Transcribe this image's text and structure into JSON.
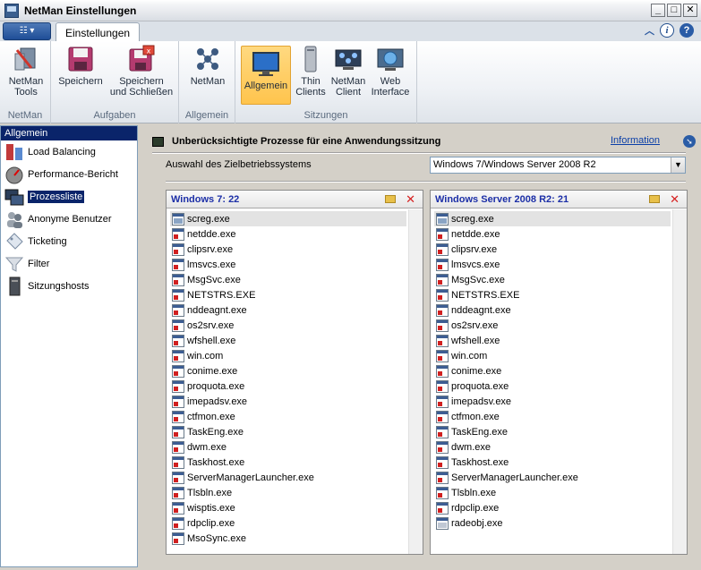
{
  "window": {
    "title": "NetMan Einstellungen",
    "controls": {
      "minimize": "_",
      "maximize": "□",
      "close": "✕"
    }
  },
  "tabs": {
    "app_menu": "☷ ▾",
    "active_tab": "Einstellungen"
  },
  "ribbon": {
    "groups": [
      {
        "label": "NetMan",
        "buttons": [
          {
            "label1": "NetMan",
            "label2": "Tools",
            "icon": "tools-icon"
          }
        ]
      },
      {
        "label": "Aufgaben",
        "buttons": [
          {
            "label1": "Speichern",
            "label2": "",
            "icon": "save-icon"
          },
          {
            "label1": "Speichern",
            "label2": "und Schließen",
            "icon": "save-close-icon"
          }
        ]
      },
      {
        "label": "Allgemein",
        "buttons": [
          {
            "label1": "NetMan",
            "label2": "",
            "icon": "network-icon"
          }
        ]
      },
      {
        "label": "Sitzungen",
        "buttons": [
          {
            "label1": "Allgemein",
            "label2": "",
            "icon": "monitor-icon",
            "active": true
          },
          {
            "label1": "Thin",
            "label2": "Clients",
            "icon": "thin-client-icon"
          },
          {
            "label1": "NetMan",
            "label2": "Client",
            "icon": "netman-client-icon"
          },
          {
            "label1": "Web",
            "label2": "Interface",
            "icon": "web-interface-icon"
          }
        ]
      }
    ]
  },
  "sidebar": {
    "header": "Allgemein",
    "items": [
      {
        "label": "Load Balancing",
        "icon": "load-balancing-icon"
      },
      {
        "label": "Performance-Bericht",
        "icon": "performance-icon"
      },
      {
        "label": "Prozessliste",
        "icon": "process-list-icon",
        "selected": true
      },
      {
        "label": "Anonyme Benutzer",
        "icon": "anonymous-users-icon"
      },
      {
        "label": "Ticketing",
        "icon": "ticket-icon"
      },
      {
        "label": "Filter",
        "icon": "filter-icon"
      },
      {
        "label": "Sitzungshosts",
        "icon": "session-host-icon"
      }
    ]
  },
  "main": {
    "section_title": "Unberücksichtigte Prozesse für eine Anwendungssitzung",
    "info_link": "Information",
    "os_label": "Auswahl des Zielbetriebssystems",
    "os_selected": "Windows 7/Windows Server 2008 R2",
    "panels": [
      {
        "title": "Windows 7: 22",
        "items": [
          "screg.exe",
          "netdde.exe",
          "clipsrv.exe",
          "lmsvcs.exe",
          "MsgSvc.exe",
          "NETSTRS.EXE",
          "nddeagnt.exe",
          "os2srv.exe",
          "wfshell.exe",
          "win.com",
          "conime.exe",
          "proquota.exe",
          "imepadsv.exe",
          "ctfmon.exe",
          "TaskEng.exe",
          "dwm.exe",
          "Taskhost.exe",
          "ServerManagerLauncher.exe",
          "Tlsbln.exe",
          "wisptis.exe",
          "rdpclip.exe",
          "MsoSync.exe"
        ]
      },
      {
        "title": "Windows Server 2008 R2: 21",
        "items": [
          "screg.exe",
          "netdde.exe",
          "clipsrv.exe",
          "lmsvcs.exe",
          "MsgSvc.exe",
          "NETSTRS.EXE",
          "nddeagnt.exe",
          "os2srv.exe",
          "wfshell.exe",
          "win.com",
          "conime.exe",
          "proquota.exe",
          "imepadsv.exe",
          "ctfmon.exe",
          "TaskEng.exe",
          "dwm.exe",
          "Taskhost.exe",
          "ServerManagerLauncher.exe",
          "Tlsbln.exe",
          "rdpclip.exe",
          "radeobj.exe"
        ]
      }
    ]
  }
}
